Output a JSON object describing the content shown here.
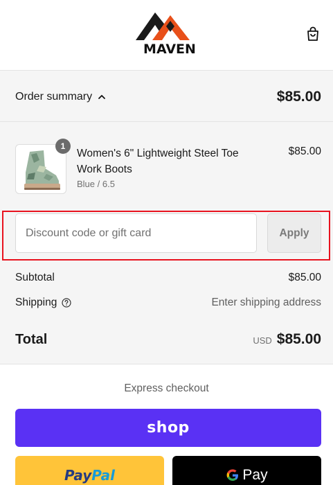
{
  "header": {
    "logo_text": "MAVEN",
    "cart_icon": "shopping-bag-icon"
  },
  "summary": {
    "toggle_label": "Order summary",
    "toggle_icon": "chevron-up-icon",
    "total": "$85.00"
  },
  "product": {
    "quantity": "1",
    "name": "Women's 6\" Lightweight Steel Toe Work Boots",
    "variant": "Blue / 6.5",
    "price": "$85.00"
  },
  "discount": {
    "placeholder": "Discount code or gift card",
    "apply_label": "Apply"
  },
  "costs": {
    "subtotal_label": "Subtotal",
    "subtotal_value": "$85.00",
    "shipping_label": "Shipping",
    "shipping_value": "Enter shipping address",
    "total_label": "Total",
    "currency": "USD",
    "total_value": "$85.00"
  },
  "express": {
    "title": "Express checkout",
    "shop_label": "shop",
    "paypal_label_1": "Pay",
    "paypal_label_2": "Pal",
    "gpay_label": "Pay"
  },
  "colors": {
    "highlight": "#e8121e",
    "shop_purple": "#5a31f4",
    "paypal_yellow": "#ffc439",
    "logo_orange": "#e8501a"
  }
}
